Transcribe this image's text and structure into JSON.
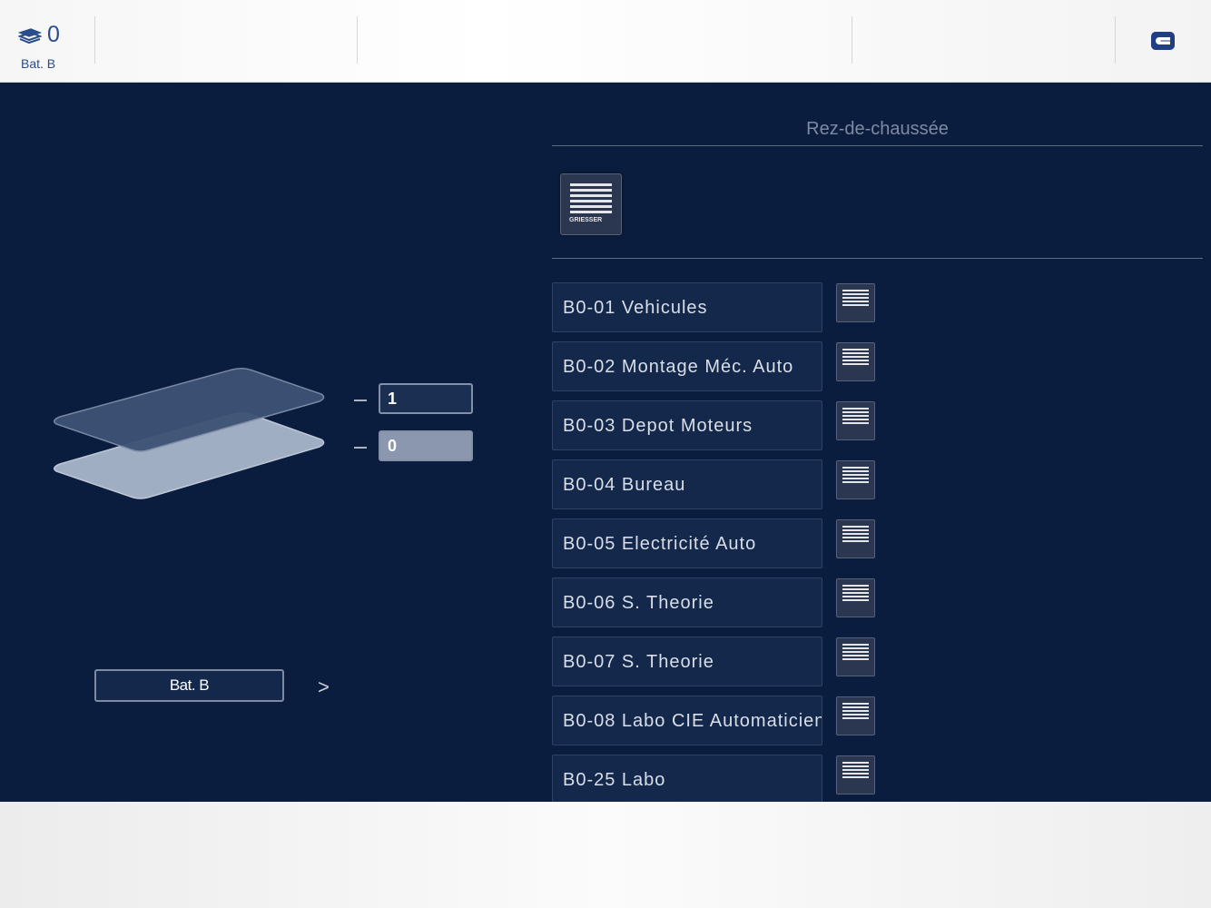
{
  "topbar": {
    "floor_value": "0",
    "building_label": "Bat. B",
    "brand_color": "#1f3f82"
  },
  "main": {
    "floor_title": "Rez-de-chaussée",
    "brand_text": "GRIESSER",
    "levels": [
      "1",
      "0"
    ],
    "building_button": "Bat. B",
    "next_symbol": ">",
    "rooms": [
      {
        "label": "B0-01 Vehicules"
      },
      {
        "label": "B0-02 Montage Méc. Auto"
      },
      {
        "label": "B0-03 Depot Moteurs"
      },
      {
        "label": "B0-04 Bureau"
      },
      {
        "label": "B0-05 Electricité Auto"
      },
      {
        "label": "B0-06 S. Theorie"
      },
      {
        "label": "B0-07 S. Theorie"
      },
      {
        "label": "B0-08 Labo CIE Automaticien"
      },
      {
        "label": "B0-25 Labo"
      }
    ]
  },
  "colors": {
    "background": "#0b1d3e",
    "room_button": "#13284b",
    "top_level_plate": "#3d5275",
    "selected_level_plate": "#a9b6cb"
  }
}
